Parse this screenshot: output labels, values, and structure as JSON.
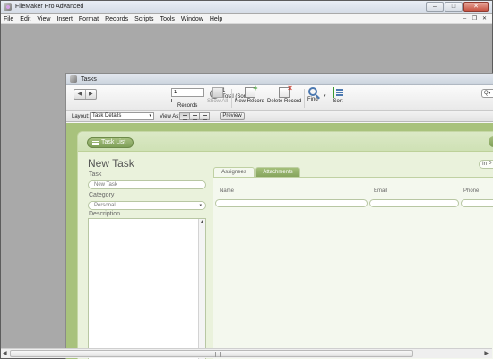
{
  "app": {
    "title": "FileMaker Pro Advanced",
    "window_controls": {
      "minimize": "–",
      "maximize": "□",
      "close": "✕"
    }
  },
  "menubar": {
    "items": [
      "File",
      "Edit",
      "View",
      "Insert",
      "Format",
      "Records",
      "Scripts",
      "Tools",
      "Window",
      "Help"
    ],
    "controls": {
      "minimize": "–",
      "restore": "❐",
      "close": "✕"
    }
  },
  "child_window": {
    "title": "Tasks"
  },
  "toolbar": {
    "record_number": "1",
    "records_label": "Records",
    "found_count": "1",
    "total_label": "Total (Sorted)",
    "show_all_label": "Show All",
    "new_record_label": "New Record",
    "delete_record_label": "Delete Record",
    "find_label": "Find",
    "sort_label": "Sort",
    "quick_find_text": "Q▾"
  },
  "layout_bar": {
    "layout_label": "Layout:",
    "layout_value": "Task Details",
    "view_as_label": "View As:",
    "preview_label": "Preview"
  },
  "form": {
    "task_list_button": "Task List",
    "record_title": "New Task",
    "in_progress_button": "In P",
    "task_label": "Task",
    "task_placeholder": "New Task",
    "category_label": "Category",
    "category_value": "Personal",
    "description_label": "Description",
    "tabs": [
      "Assignees",
      "Attachments"
    ],
    "columns": [
      "Name",
      "Email",
      "Phone"
    ]
  },
  "colors": {
    "accent_green": "#8aa862",
    "background_green": "#a8c27c",
    "card_green": "#eaf2dc"
  }
}
